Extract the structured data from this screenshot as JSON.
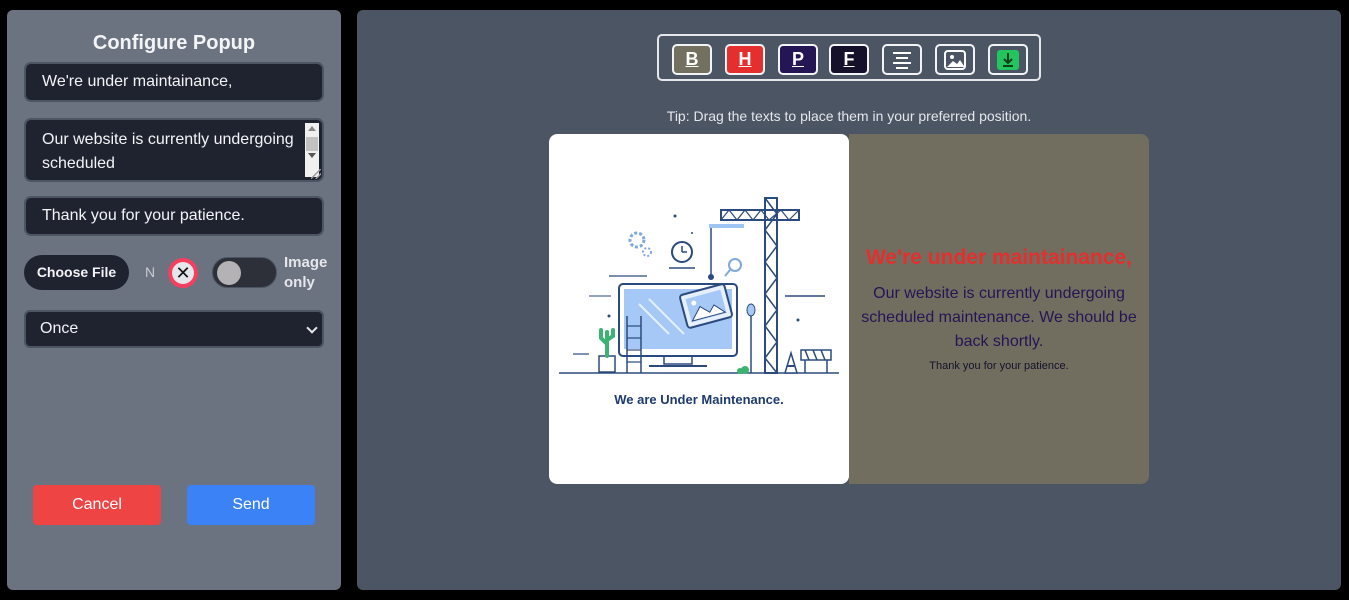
{
  "config": {
    "title": "Configure Popup",
    "heading_value": "We're under maintainance,",
    "body_value": "Our website is currently undergoing scheduled",
    "footer_value": "Thank you for your patience.",
    "choose_file_label": "Choose File",
    "file_name": "N",
    "image_only_label": "Image only",
    "image_only_enabled": false,
    "frequency_selected": "Once",
    "cancel_label": "Cancel",
    "send_label": "Send"
  },
  "toolbar": {
    "bold": "B",
    "heading": "H",
    "paragraph": "P",
    "footer": "F",
    "align_icon": "align-center-icon",
    "image_icon": "image-icon",
    "download_icon": "download-icon"
  },
  "tip": "Tip: Drag the texts to place them in your preferred position.",
  "popup": {
    "image_caption": "We are Under Maintenance.",
    "heading": "We're under maintainance,",
    "body": "Our website is currently undergoing scheduled maintenance. We should be back shortly.",
    "footer": "Thank you for your patience.",
    "colors": {
      "background": "#726e5f",
      "heading": "#e52e2e",
      "body": "#241555",
      "footer": "#15112a"
    }
  }
}
